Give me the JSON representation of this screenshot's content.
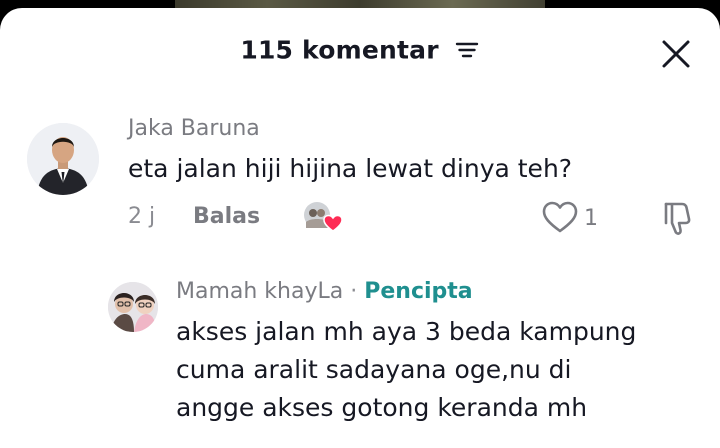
{
  "header": {
    "title": "115 komentar",
    "filter_icon": "filter-lines-icon",
    "close_icon": "close-x-icon"
  },
  "comments": [
    {
      "username": "Jaka Baruna",
      "text": "eta jalan hiji hijina lewat dinya teh?",
      "time": "2 j",
      "reply_label": "Balas",
      "like_count": "1",
      "liked_by_creator": true
    }
  ],
  "reply": {
    "username": "Mamah khayLa",
    "separator": "·",
    "badge": "Pencipta",
    "text_lines": [
      "akses jalan mh aya 3 beda kampung",
      "cuma aralit sadayana oge,nu di",
      "angge akses gotong keranda mh"
    ]
  },
  "colors": {
    "text": "#161823",
    "muted": "#7a7b81",
    "badge": "#1f8f8f",
    "heart": "#fe2c55"
  }
}
